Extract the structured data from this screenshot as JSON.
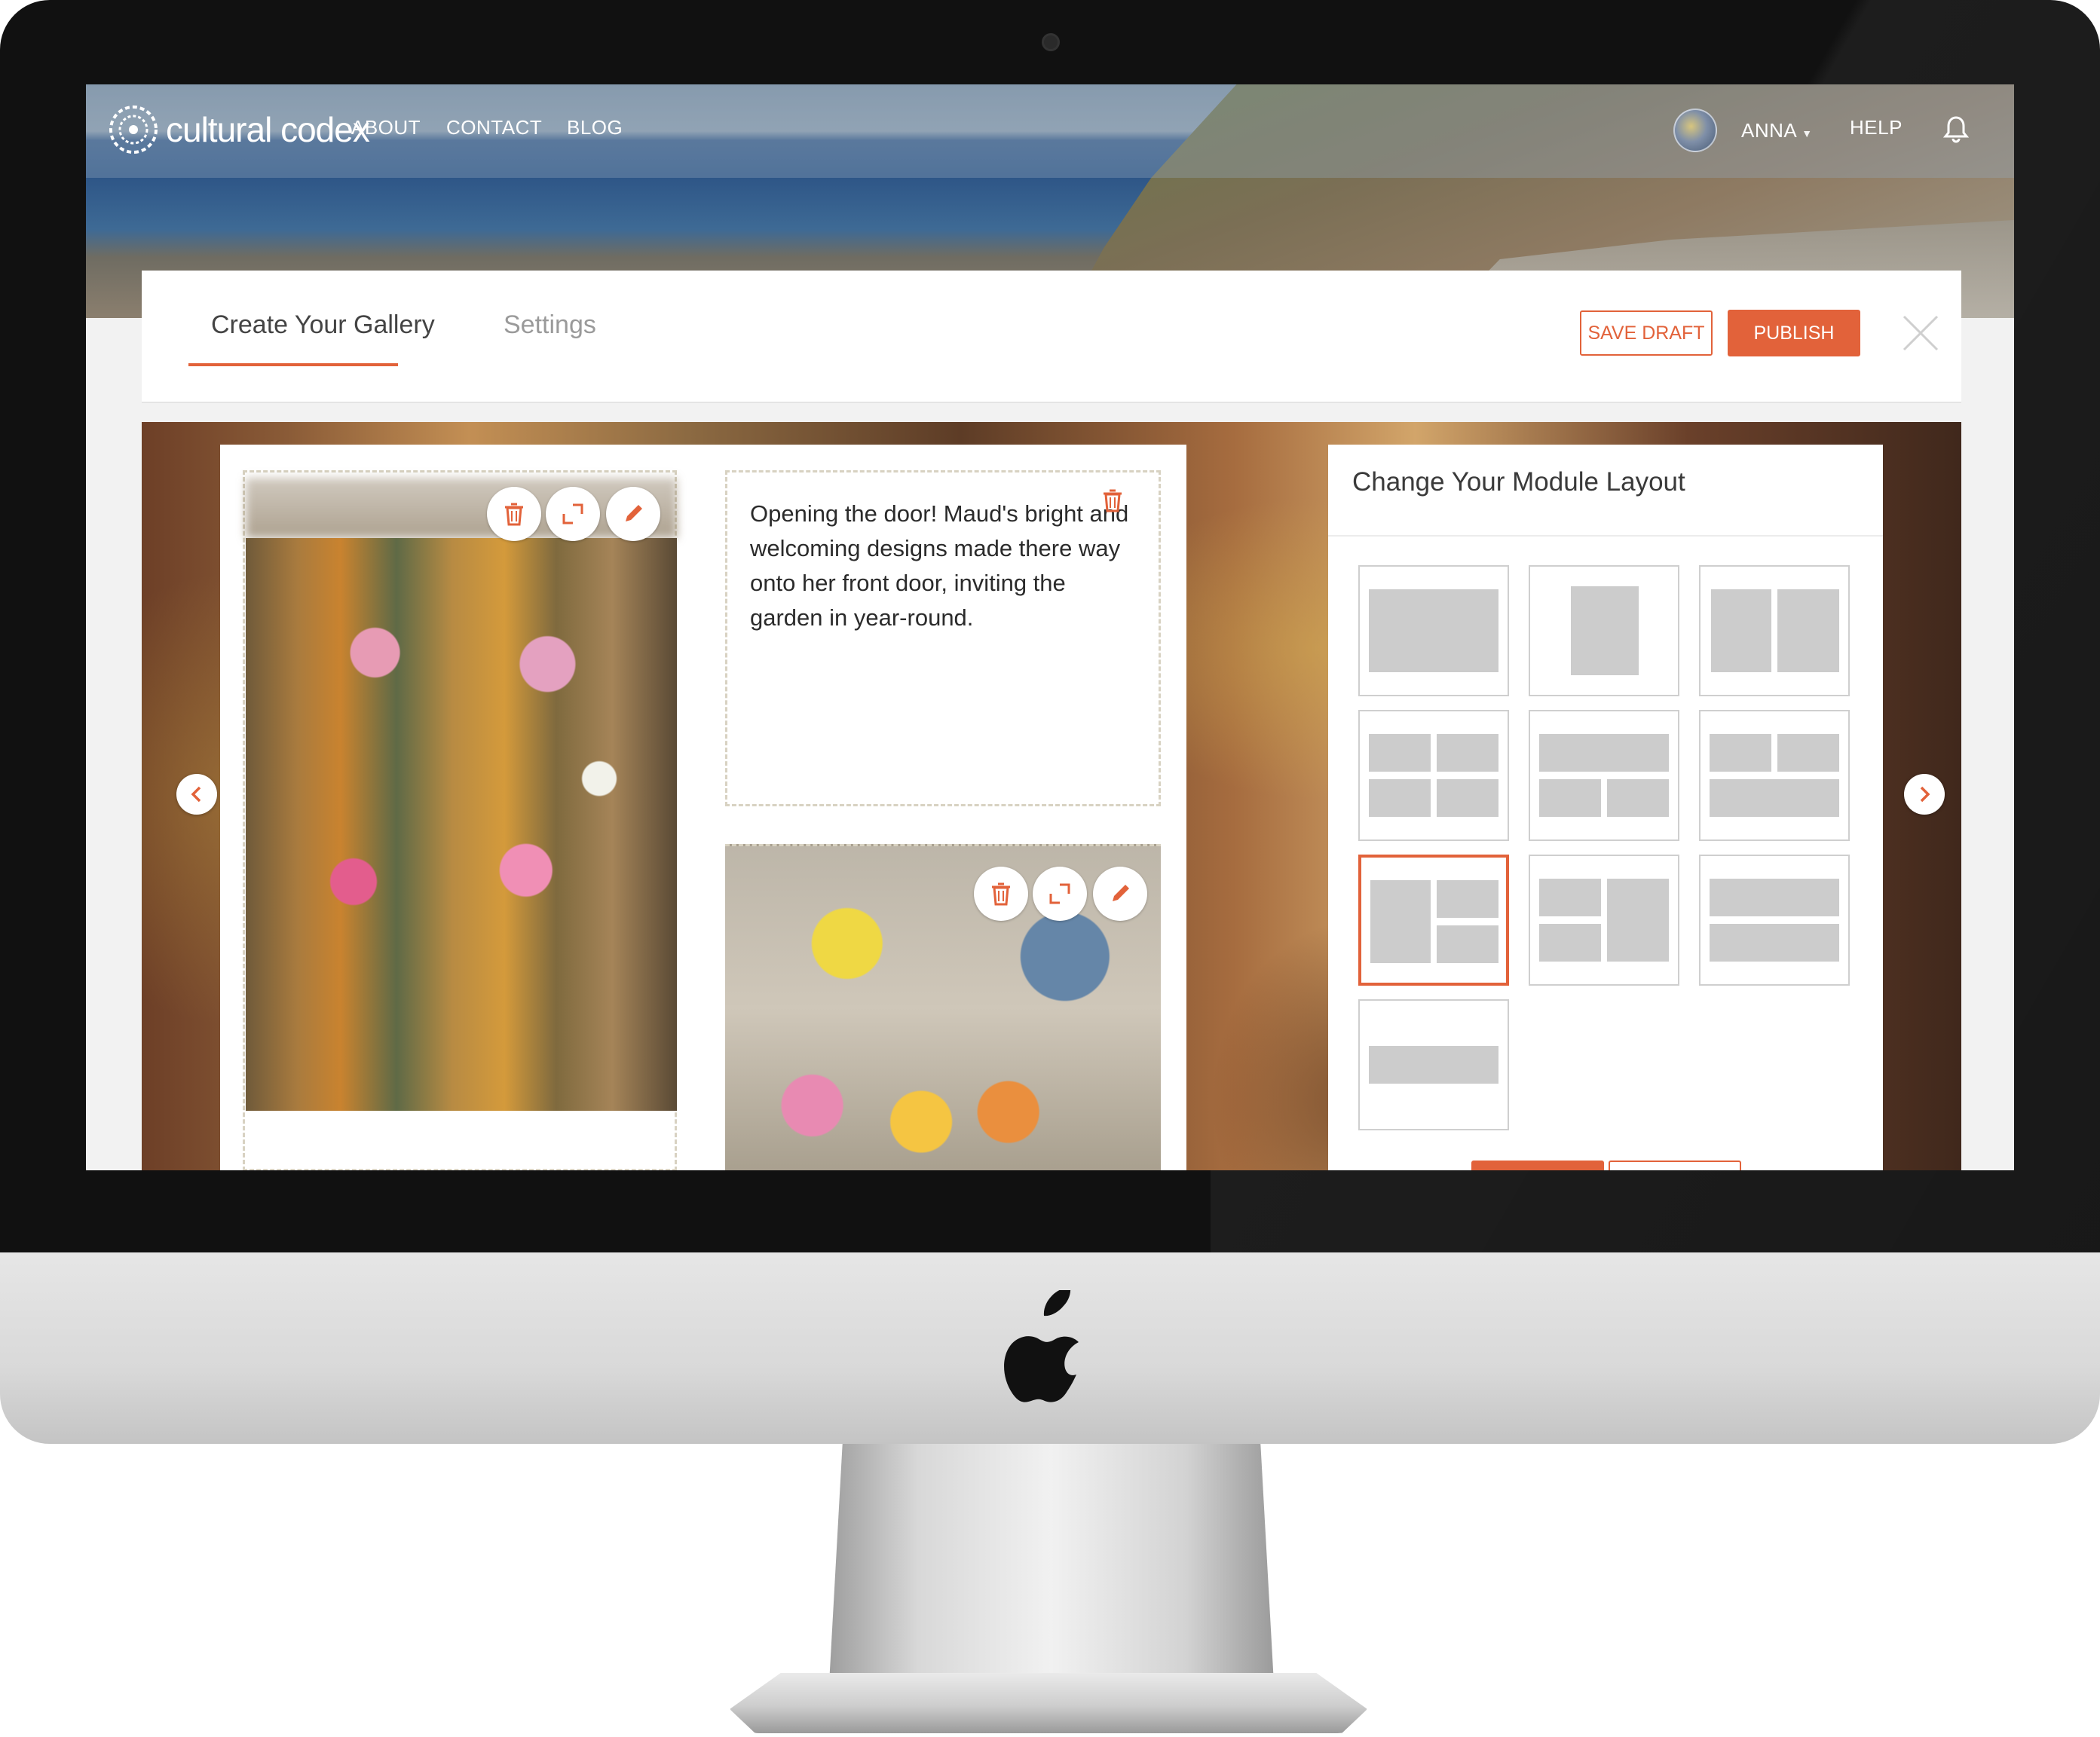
{
  "nav": {
    "logo_text": "cultural codex",
    "links": [
      "ABOUT",
      "CONTACT",
      "BLOG"
    ],
    "user_name": "ANNA",
    "help": "HELP"
  },
  "editor": {
    "tabs": [
      "Create Your Gallery",
      "Settings"
    ],
    "active_tab": "Create Your Gallery",
    "save_draft": "SAVE DRAFT",
    "publish": "PUBLISH"
  },
  "module": {
    "caption": "Opening the door! Maud's bright and welcoming designs made there way onto her front door, inviting the garden in year-round."
  },
  "layout_panel": {
    "title": "Change Your Module Layout",
    "layout_options": 10,
    "selected_layout_index": 7
  },
  "colors": {
    "accent": "#e2623a",
    "tile_block": "#cccccc"
  },
  "icons": [
    "trash-icon",
    "resize-icon",
    "pencil-icon",
    "bell-icon",
    "close-icon",
    "chevron-left-icon",
    "chevron-right-icon",
    "apple-logo-icon"
  ]
}
